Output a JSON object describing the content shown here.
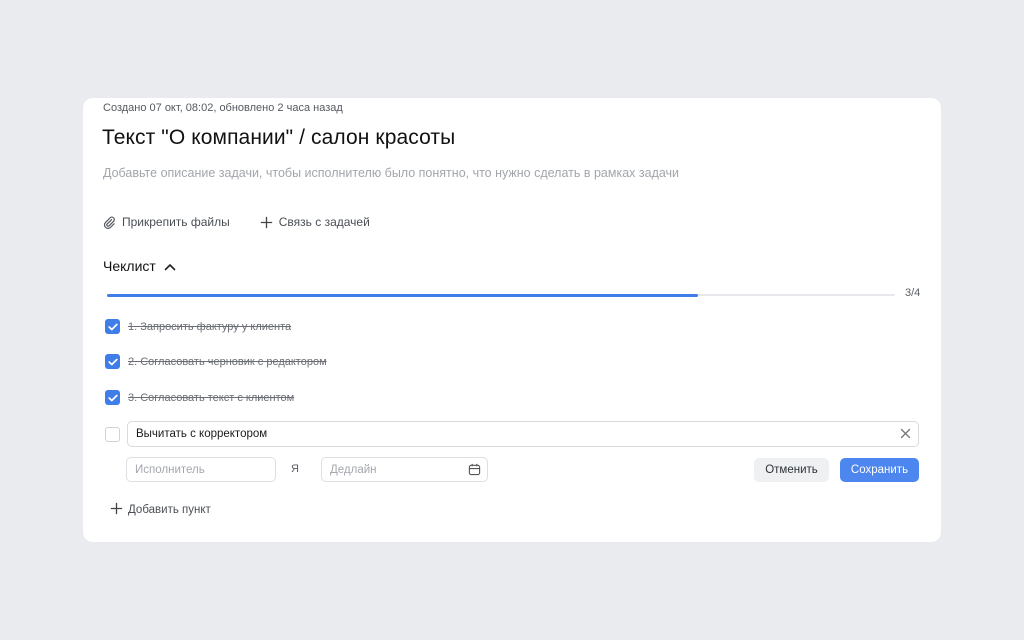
{
  "task": {
    "meta": "Создано 07 окт, 08:02, обновлено 2 часа назад",
    "title": "Текст \"О компании\" / салон красоты",
    "description_placeholder": "Добавьте описание задачи, чтобы исполнителю было понятно, что нужно сделать в рамках задачи"
  },
  "actions": [
    {
      "label": "Прикрепить файлы",
      "icon": "paperclip-icon"
    },
    {
      "label": "Связь с задачей",
      "icon": "plus-icon"
    }
  ],
  "checklist": {
    "title": "Чеклист",
    "expanded": true,
    "progress_text": "3/4",
    "progress_fraction": 0.75,
    "items": [
      {
        "text": "1. Запросить фактуру у клиента",
        "checked": true
      },
      {
        "text": "2. Согласовать черновик с редактором",
        "checked": true
      },
      {
        "text": "3. Согласовать текст с клиентом",
        "checked": true
      }
    ],
    "editing": {
      "value": "Вычитать с корректором",
      "checked": false,
      "assignee_placeholder": "Исполнитель",
      "me_label": "Я",
      "deadline_placeholder": "Дедлайн",
      "cancel_label": "Отменить",
      "save_label": "Сохранить"
    },
    "add_item_label": "Добавить пункт"
  },
  "colors": {
    "accent": "#3f7ee8",
    "save_button": "#4c86ee",
    "background": "#e9ebee"
  }
}
